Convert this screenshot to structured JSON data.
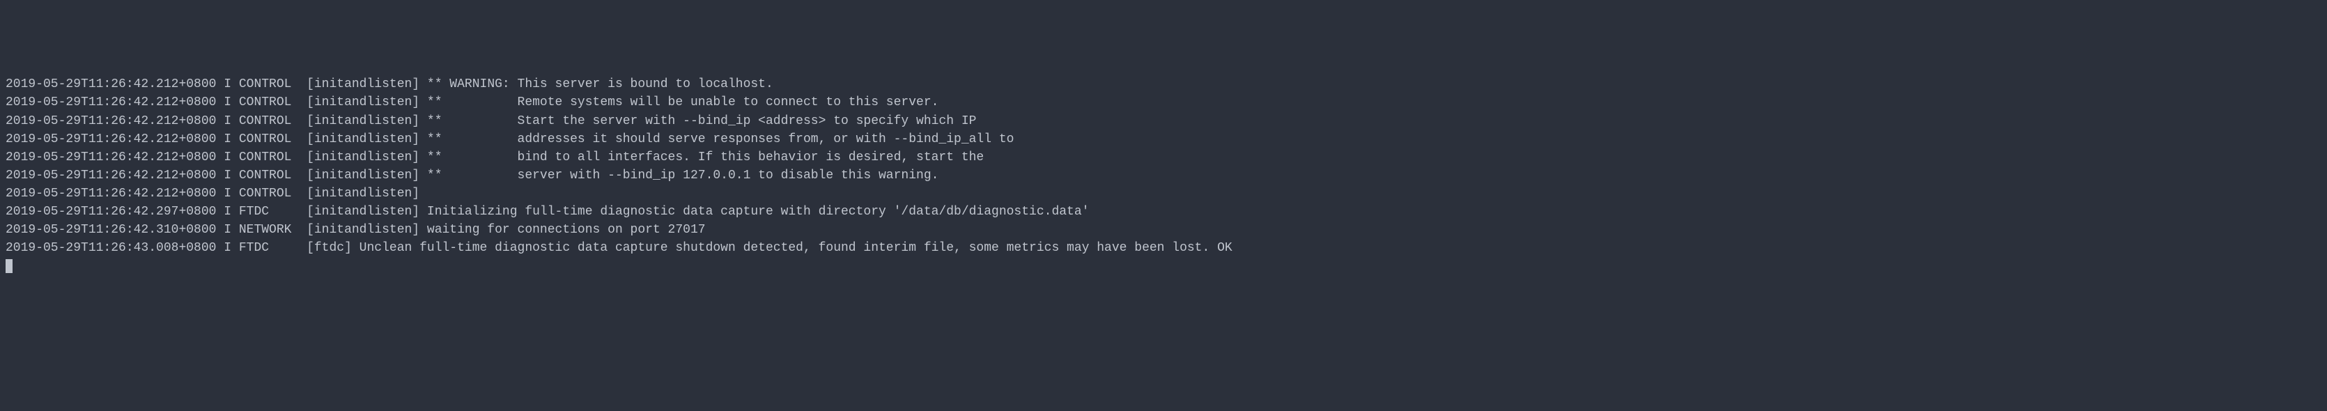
{
  "lines": [
    {
      "timestamp": "2019-05-29T11:26:42.212+0800",
      "level": "I",
      "component": "CONTROL",
      "context": "[initandlisten]",
      "message": "** WARNING: This server is bound to localhost."
    },
    {
      "timestamp": "2019-05-29T11:26:42.212+0800",
      "level": "I",
      "component": "CONTROL",
      "context": "[initandlisten]",
      "message": "**          Remote systems will be unable to connect to this server."
    },
    {
      "timestamp": "2019-05-29T11:26:42.212+0800",
      "level": "I",
      "component": "CONTROL",
      "context": "[initandlisten]",
      "message": "**          Start the server with --bind_ip <address> to specify which IP"
    },
    {
      "timestamp": "2019-05-29T11:26:42.212+0800",
      "level": "I",
      "component": "CONTROL",
      "context": "[initandlisten]",
      "message": "**          addresses it should serve responses from, or with --bind_ip_all to"
    },
    {
      "timestamp": "2019-05-29T11:26:42.212+0800",
      "level": "I",
      "component": "CONTROL",
      "context": "[initandlisten]",
      "message": "**          bind to all interfaces. If this behavior is desired, start the"
    },
    {
      "timestamp": "2019-05-29T11:26:42.212+0800",
      "level": "I",
      "component": "CONTROL",
      "context": "[initandlisten]",
      "message": "**          server with --bind_ip 127.0.0.1 to disable this warning."
    },
    {
      "timestamp": "2019-05-29T11:26:42.212+0800",
      "level": "I",
      "component": "CONTROL",
      "context": "[initandlisten]",
      "message": ""
    },
    {
      "timestamp": "2019-05-29T11:26:42.297+0800",
      "level": "I",
      "component": "FTDC",
      "context": "[initandlisten]",
      "message": "Initializing full-time diagnostic data capture with directory '/data/db/diagnostic.data'"
    },
    {
      "timestamp": "2019-05-29T11:26:42.310+0800",
      "level": "I",
      "component": "NETWORK",
      "context": "[initandlisten]",
      "message": "waiting for connections on port 27017"
    },
    {
      "timestamp": "2019-05-29T11:26:43.008+0800",
      "level": "I",
      "component": "FTDC",
      "context": "[ftdc]",
      "message": "Unclean full-time diagnostic data capture shutdown detected, found interim file, some metrics may have been lost. OK"
    }
  ]
}
